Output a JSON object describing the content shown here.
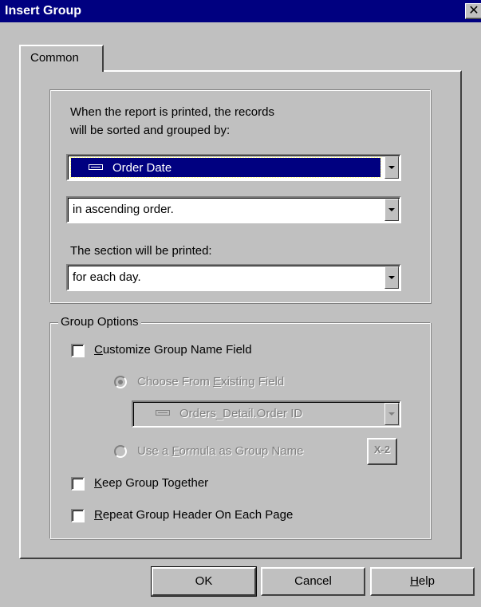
{
  "window": {
    "title": "Insert Group",
    "close_icon": "close-icon",
    "close_glyph": "✕"
  },
  "tabs": [
    {
      "label": "Common"
    }
  ],
  "sort_section": {
    "intro_line1": "When the report is printed, the records",
    "intro_line2": "will be sorted and grouped by:",
    "field_value": "Order Date",
    "field_icon": "database-field-icon",
    "order_value": "in ascending order.",
    "section_label": "The section will be printed:",
    "section_value": "for each day."
  },
  "group_options": {
    "legend": "Group Options",
    "customize": {
      "label_u": "C",
      "label_rest": "ustomize Group Name Field",
      "checked": false
    },
    "choose_existing": {
      "pre": "Choose From ",
      "u": "E",
      "post": "xisting Field",
      "selected": true,
      "disabled": true
    },
    "existing_field_value": "Orders_Detail.Order ID",
    "use_formula": {
      "pre": "Use a ",
      "u": "F",
      "post": "ormula as Group Name",
      "selected": false,
      "disabled": true
    },
    "formula_button_glyph": "X-2",
    "formula_icon": "formula-editor-icon",
    "keep_together": {
      "label_u": "K",
      "label_rest": "eep Group Together",
      "checked": false
    },
    "repeat_header": {
      "label_u": "R",
      "label_rest": "epeat Group Header On Each Page",
      "checked": false
    }
  },
  "buttons": {
    "ok": "OK",
    "cancel": "Cancel",
    "help_u": "H",
    "help_rest": "elp"
  },
  "colors": {
    "titlebar": "#000080",
    "face": "#c0c0c0",
    "selection": "#000080"
  }
}
